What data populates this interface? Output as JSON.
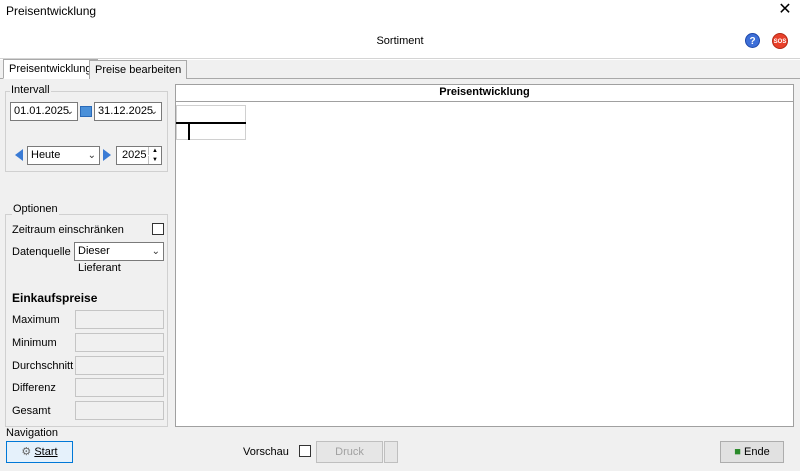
{
  "window": {
    "title": "Preisentwicklung",
    "close_glyph": "✕"
  },
  "header": {
    "title": "Sortiment",
    "help_glyph": "?",
    "sos_text": "SOS"
  },
  "tabs": [
    {
      "label": "Preisentwicklung",
      "active": true
    },
    {
      "label": "Preise bearbeiten",
      "active": false
    }
  ],
  "interval": {
    "group_label": "Intervall",
    "date_from": "01.01.2025",
    "date_to": "31.12.2025",
    "period": "Heute",
    "year": "2025"
  },
  "options": {
    "group_label": "Optionen",
    "restrict_label": "Zeitraum einschränken",
    "restrict_checked": false,
    "datasource_label": "Datenquelle",
    "datasource_value": "Dieser Lieferant"
  },
  "purchase_prices": {
    "title": "Einkaufspreise",
    "fields": [
      {
        "label": "Maximum",
        "value": ""
      },
      {
        "label": "Minimum",
        "value": ""
      },
      {
        "label": "Durchschnitt",
        "value": ""
      },
      {
        "label": "Differenz",
        "value": ""
      },
      {
        "label": "Gesamt",
        "value": ""
      }
    ]
  },
  "panel": {
    "title": "Preisentwicklung"
  },
  "navigation": {
    "label": "Navigation",
    "start_label": "Start",
    "preview_label": "Vorschau",
    "preview_checked": false,
    "print_label": "Druck",
    "end_label": "Ende"
  },
  "colors": {
    "accent": "#0078d7",
    "nav_arrow": "#3a7bd5",
    "sos": "#e8402a",
    "help": "#3d6fd8"
  }
}
